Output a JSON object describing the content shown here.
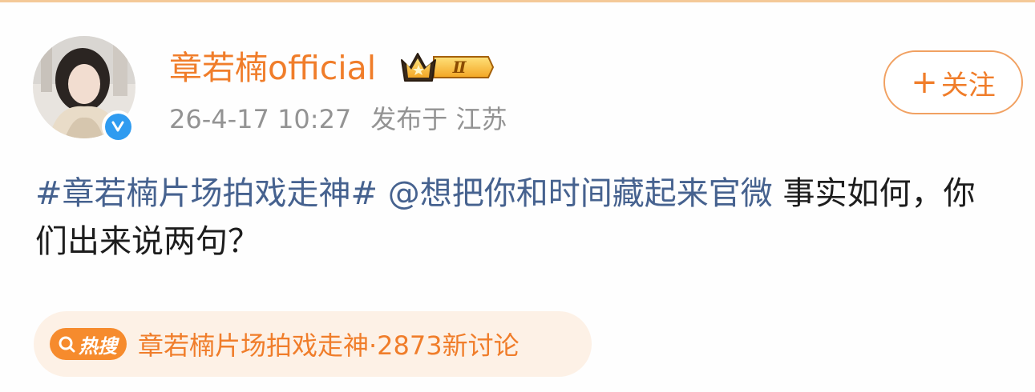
{
  "author": {
    "name": "章若楠official",
    "badge_level": "Ⅱ",
    "timestamp": "26-4-17 10:27",
    "location": "发布于 江苏",
    "verified": true
  },
  "follow_button": {
    "label": "关注",
    "plus": "+"
  },
  "post": {
    "hashtag": "#章若楠片场拍戏走神#",
    "mention": "@想把你和时间藏起来官微",
    "text": " 事实如何，你们出来说两句？"
  },
  "hot_search": {
    "tag_label": "热搜",
    "text": "章若楠片场拍戏走神·2873新讨论"
  },
  "colors": {
    "accent_orange": "#f07d2a",
    "link_blue": "#46628f",
    "meta_gray": "#939393",
    "verified_blue": "#2f9bf0"
  }
}
